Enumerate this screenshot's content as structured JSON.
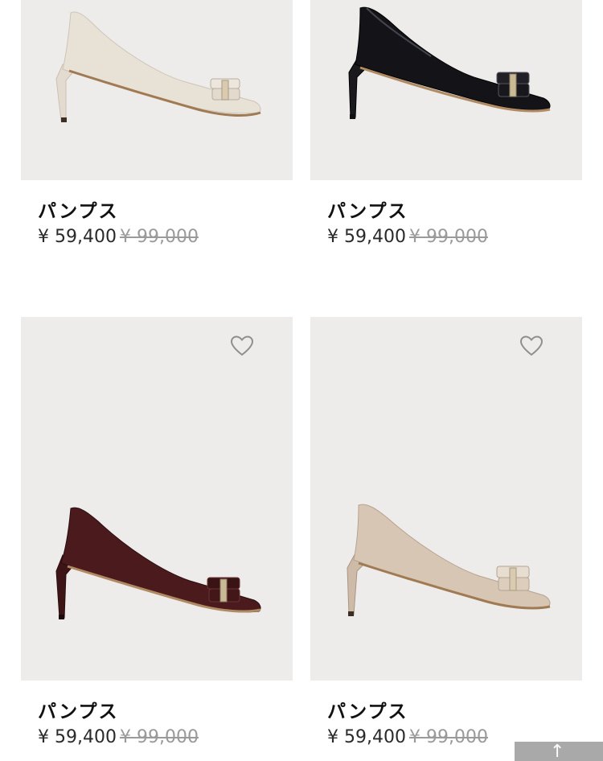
{
  "products": [
    {
      "name": "パンプス",
      "price": "¥ 59,400",
      "original_price": "¥ 99,000",
      "color": "#e8e1d6",
      "show_favorite": false
    },
    {
      "name": "パンプス",
      "price": "¥ 59,400",
      "original_price": "¥ 99,000",
      "color": "#141418",
      "show_favorite": false
    },
    {
      "name": "パンプス",
      "price": "¥ 59,400",
      "original_price": "¥ 99,000",
      "color": "#4a1a1c",
      "show_favorite": true
    },
    {
      "name": "パンプス",
      "price": "¥ 59,400",
      "original_price": "¥ 99,000",
      "color": "#d8c6b4",
      "show_favorite": true
    }
  ],
  "icons": {
    "favorite": "heart-outline-icon",
    "scroll_top": "arrow-up-icon"
  },
  "colors": {
    "image_background": "#edecea",
    "price": "#2a2a2a",
    "original_price": "#9a9a9a",
    "scroll_top_button": "#a9a9a9"
  }
}
